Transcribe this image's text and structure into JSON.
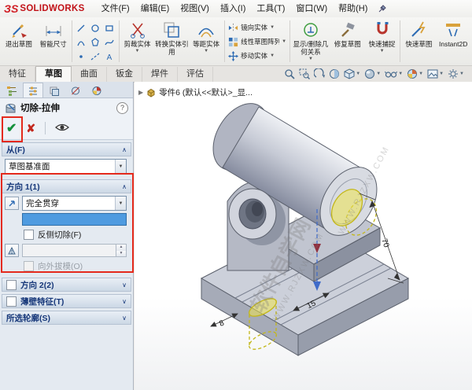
{
  "titlebar": {
    "logo": "SOLIDWORKS",
    "logo_mark": "ЗS",
    "menus": [
      "文件(F)",
      "编辑(E)",
      "视图(V)",
      "插入(I)",
      "工具(T)",
      "窗口(W)",
      "帮助(H)"
    ]
  },
  "toolbar": {
    "items": [
      "退出草图",
      "智能尺寸",
      "剪裁实体",
      "转换实体引用",
      "等距实体",
      "镜向实体",
      "线性草图阵列",
      "移动实体",
      "显示/删除几何关系",
      "修复草图",
      "快速捕捉",
      "快速草图",
      "Instant2D"
    ]
  },
  "tabs": [
    "特征",
    "草图",
    "曲面",
    "钣金",
    "焊件",
    "评估"
  ],
  "property_manager": {
    "title": "切除-拉伸",
    "help": "?",
    "from_header": "从(F)",
    "from_value": "草图基准面",
    "dir1_header": "方向 1(1)",
    "dir1_end_condition": "完全贯穿",
    "dir1_flip": "反侧切除(F)",
    "dir1_draft": "向外拔模(O)",
    "dir2_header": "方向 2(2)",
    "thin_header": "薄壁特征(T)",
    "contours_header": "所选轮廓(S)"
  },
  "viewport": {
    "tree_item": "零件6 (默认<<默认>_显...",
    "watermark_cn": "软件自学网",
    "watermark_en": "WWW.RJZXW.COM",
    "dim_height": "70",
    "dim_width": "15",
    "dim_depth": "8"
  },
  "icons": {
    "check": "✔",
    "cancel": "✘",
    "chevron_up": "∧",
    "chevron_down": "∨",
    "caret": "▼",
    "expand": "▶"
  },
  "colors": {
    "annotation_red": "#e42a1c",
    "sketch_yellow": "#c3b71a",
    "preview_blue": "#3f6bc9",
    "selection_blue": "#4f9be0"
  }
}
